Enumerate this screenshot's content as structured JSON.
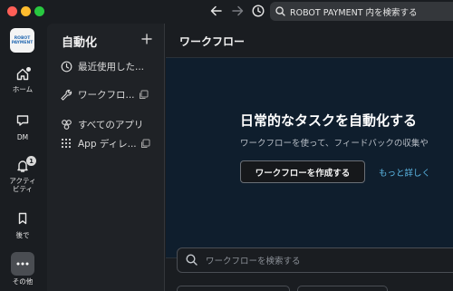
{
  "titlebar": {
    "search_text": "ROBOT PAYMENT 内を検索する",
    "icons": [
      "back-arrow-icon",
      "forward-arrow-icon",
      "history-clock-icon",
      "search-icon"
    ]
  },
  "workspace": {
    "logo_line1": "ROBOT",
    "logo_line2": "PAYMENT"
  },
  "rail": {
    "items": [
      {
        "label": "ホーム",
        "icon": "home-icon"
      },
      {
        "label": "DM",
        "icon": "dm-icon"
      },
      {
        "label": "アクティビティ",
        "label_line1": "アクティ",
        "label_line2": "ビティ",
        "icon": "bell-icon",
        "badge": "1"
      },
      {
        "label": "後で",
        "icon": "bookmark-icon"
      },
      {
        "label": "その他",
        "icon": "more-dots-icon"
      }
    ]
  },
  "sidebar": {
    "title": "自動化",
    "add_icon": "plus-icon",
    "items": [
      {
        "label": "最近使用した...",
        "icon": "clock-icon"
      },
      {
        "label": "ワークフロ...",
        "icon": "wrench-icon",
        "external_icon": "open-external-icon"
      },
      {
        "label": "すべてのアプリ",
        "icon": "apps-icon"
      },
      {
        "label": "App ディレ...",
        "icon": "grid-icon",
        "external_icon": "open-external-icon"
      }
    ]
  },
  "main": {
    "title": "ワークフロー",
    "hero": {
      "heading": "日常的なタスクを自動化する",
      "subtext": "ワークフローを使って、フィードバックの収集や",
      "create_button": "ワークフローを作成する",
      "more_link": "もっと詳しく"
    },
    "search_placeholder": "ワークフローを検索する"
  },
  "colors": {
    "background": "#1a1d21",
    "hero_background": "#0f1e2d",
    "link": "#5cb8e6"
  }
}
